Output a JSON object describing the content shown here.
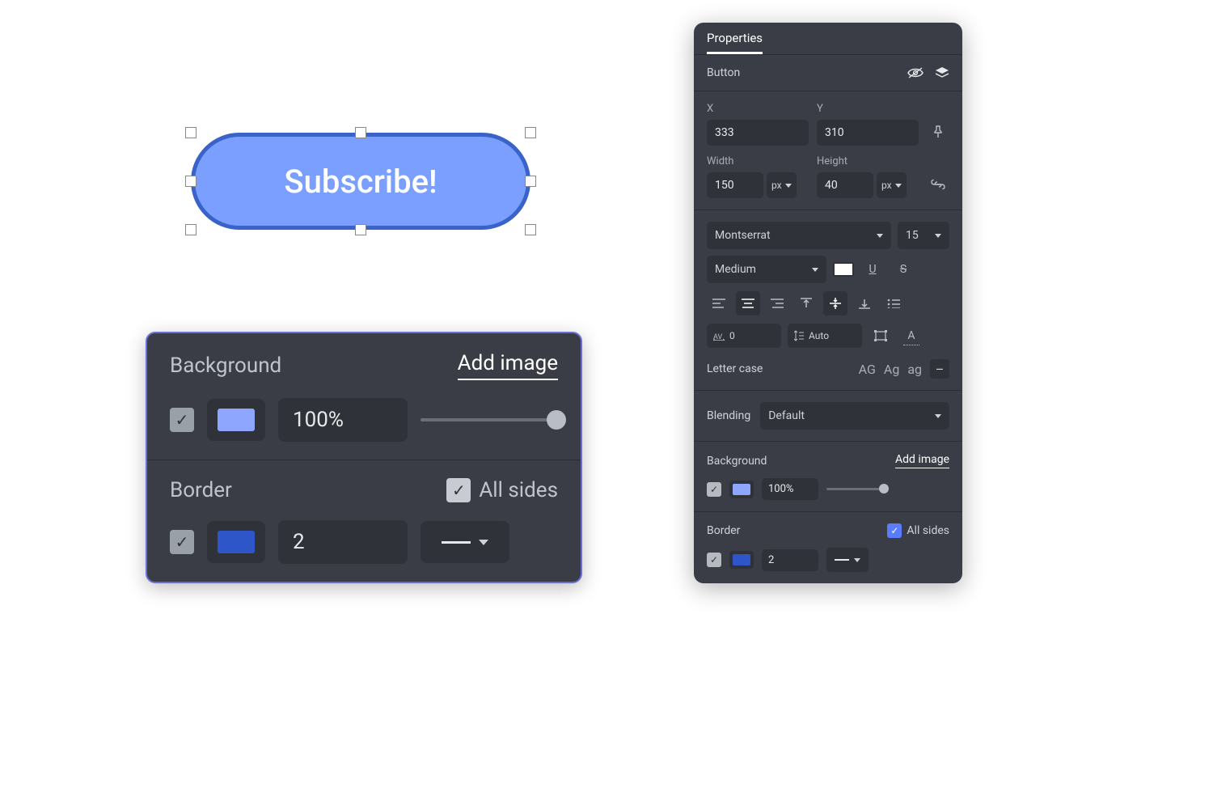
{
  "canvas": {
    "button_label": "Subscribe!"
  },
  "detail_panel": {
    "background": {
      "title": "Background",
      "add_image_label": "Add image",
      "opacity": "100%",
      "swatch_color": "#8fa6ff"
    },
    "border": {
      "title": "Border",
      "all_sides_label": "All sides",
      "width": "2",
      "swatch_color": "#2f56c9"
    }
  },
  "properties": {
    "tab_label": "Properties",
    "element_name": "Button",
    "position": {
      "x_label": "X",
      "x_value": "333",
      "y_label": "Y",
      "y_value": "310"
    },
    "size": {
      "width_label": "Width",
      "width_value": "150",
      "width_unit": "px",
      "height_label": "Height",
      "height_value": "40",
      "height_unit": "px"
    },
    "typography": {
      "font_family": "Montserrat",
      "font_size": "15",
      "font_weight": "Medium",
      "color": "#ffffff",
      "letter_spacing": "0",
      "line_height": "Auto",
      "letter_case_label": "Letter case",
      "case_upper": "AG",
      "case_title": "Ag",
      "case_lower": "ag"
    },
    "blending": {
      "label": "Blending",
      "value": "Default"
    },
    "background": {
      "title": "Background",
      "add_image_label": "Add image",
      "opacity": "100%",
      "swatch_color": "#8fa6ff"
    },
    "border": {
      "title": "Border",
      "all_sides_label": "All sides",
      "width": "2",
      "swatch_color": "#2f56c9"
    }
  }
}
